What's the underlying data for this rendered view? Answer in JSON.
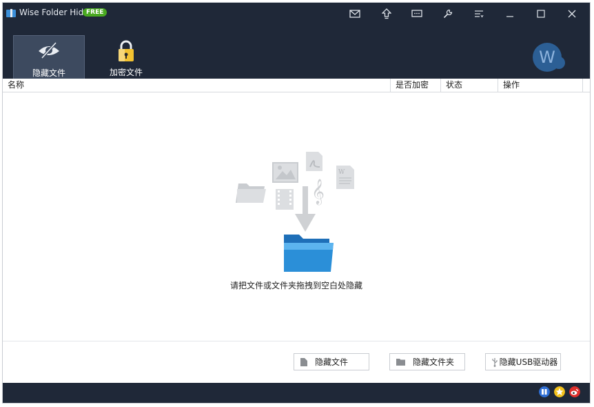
{
  "app": {
    "title": "Wise Folder Hider",
    "badge": "FREE"
  },
  "nav": {
    "tabs": [
      {
        "label": "隐藏文件",
        "active": true
      },
      {
        "label": "加密文件",
        "active": false
      }
    ]
  },
  "avatar": {
    "letter": "W"
  },
  "table": {
    "columns": [
      "名称",
      "是否加密",
      "状态",
      "操作"
    ]
  },
  "empty_state": {
    "message": "请把文件或文件夹拖拽到空白处隐藏"
  },
  "actions": {
    "hide_file": "隐藏文件",
    "hide_folder": "隐藏文件夹",
    "hide_usb": "隐藏USB驱动器"
  },
  "colors": {
    "dark_bg": "#1f2838",
    "active_tab": "#3d4a5f",
    "badge_green": "#49a920",
    "folder_blue": "#2b8fd8"
  }
}
